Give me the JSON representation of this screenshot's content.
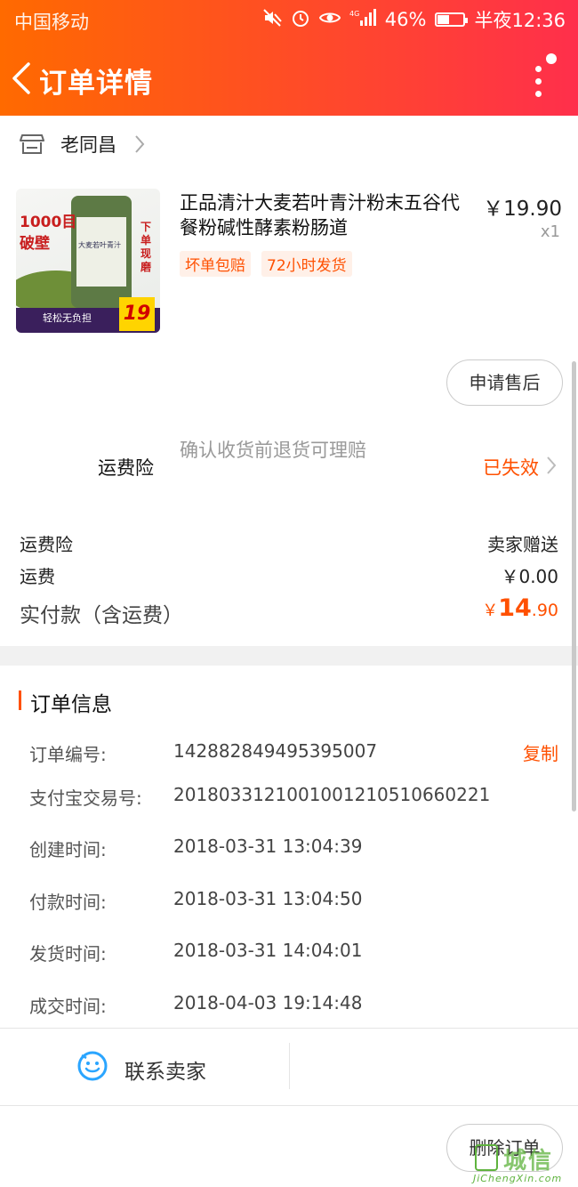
{
  "status_bar": {
    "carrier": "中国移动",
    "battery": "46%",
    "battery_level": 0.46,
    "time": "半夜12:36"
  },
  "nav": {
    "title": "订单详情"
  },
  "shop": {
    "name": "老同昌"
  },
  "product": {
    "title": "正品清汁大麦若叶青汁粉末五谷代餐粉碱性酵素粉肠道",
    "price": "￥19.90",
    "quantity": "x1",
    "tags": [
      "坏单包赔",
      "72小时发货"
    ],
    "image_text": {
      "mesh": "1000目",
      "wall": "破壁",
      "side": "下单现磨",
      "label": "大麦若叶青汁",
      "promo": "轻松无负担",
      "price": "19"
    }
  },
  "after_sale_button": "申请售后",
  "insurance": {
    "label": "运费险",
    "description": "确认收货前退货可理赔",
    "status": "已失效"
  },
  "fees": [
    {
      "label": "运费险",
      "value": "卖家赠送"
    },
    {
      "label": "运费",
      "value": "￥0.00"
    }
  ],
  "paid": {
    "label": "实付款（含运费）",
    "currency": "￥",
    "integer": "14",
    "decimal": ".90"
  },
  "order_info": {
    "title": "订单信息",
    "copy_label": "复制",
    "rows": [
      {
        "key": "订单编号:",
        "value": "142882849495395007"
      },
      {
        "key": "支付宝交易号:",
        "value": "2018033121001001210510660221"
      },
      {
        "key": "创建时间:",
        "value": "2018-03-31 13:04:39"
      },
      {
        "key": "付款时间:",
        "value": "2018-03-31 13:04:50"
      },
      {
        "key": "发货时间:",
        "value": "2018-03-31 14:04:01"
      },
      {
        "key": "成交时间:",
        "value": "2018-04-03 19:14:48"
      }
    ]
  },
  "bottom": {
    "contact_label": "联系卖家",
    "delete_label": "删除订单"
  },
  "watermark": {
    "text": "城信",
    "url": "JiChengXin.com"
  },
  "colors": {
    "accent": "#ff5000",
    "header_start": "#ff6a00",
    "header_end": "#ff2f4b",
    "muted": "#999999"
  }
}
